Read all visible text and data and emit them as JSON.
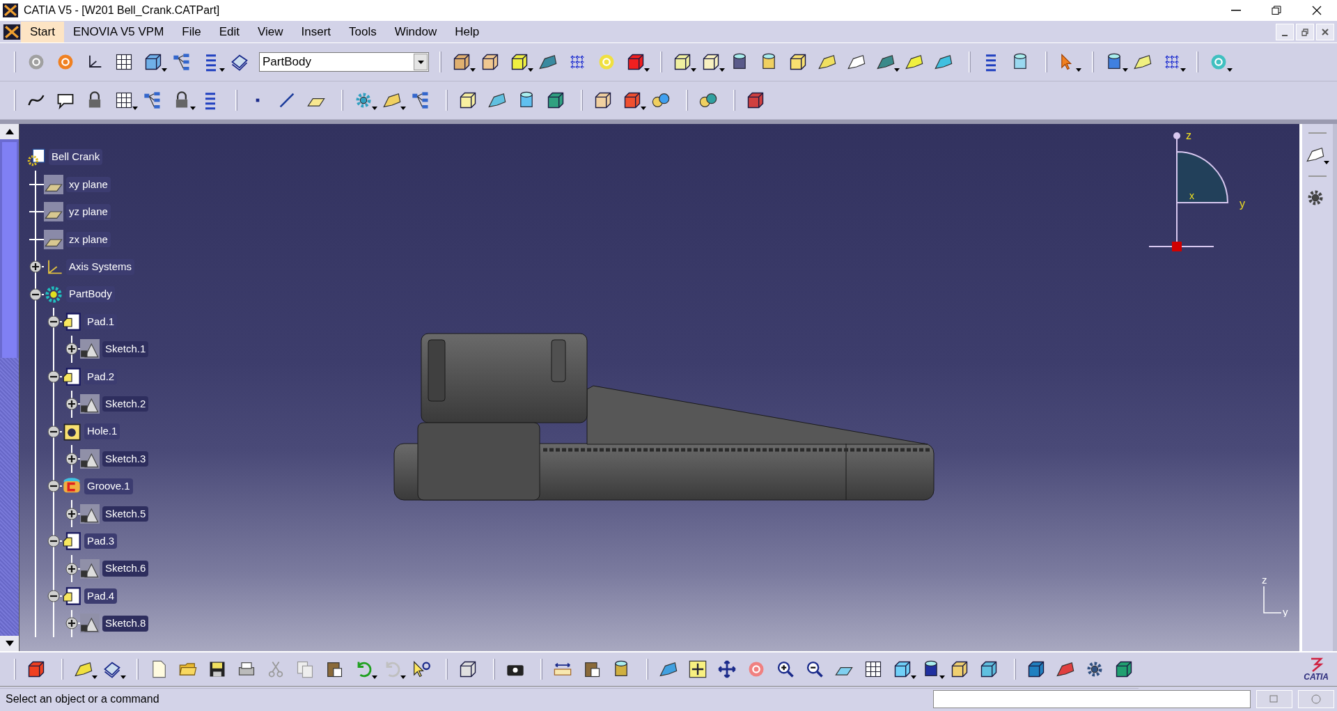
{
  "window": {
    "title": "CATIA V5 - [W201 Bell_Crank.CATPart]"
  },
  "menu": [
    {
      "label": "Start",
      "selected": true
    },
    {
      "label": "ENOVIA V5 VPM",
      "selected": false
    },
    {
      "label": "File",
      "selected": false
    },
    {
      "label": "Edit",
      "selected": false
    },
    {
      "label": "View",
      "selected": false
    },
    {
      "label": "Insert",
      "selected": false
    },
    {
      "label": "Tools",
      "selected": false
    },
    {
      "label": "Window",
      "selected": false
    },
    {
      "label": "Help",
      "selected": false
    }
  ],
  "toolbar": {
    "body_selector": "PartBody"
  },
  "tree": {
    "label": "Bell Crank",
    "kind": "part",
    "children": [
      {
        "label": "xy plane",
        "kind": "plane"
      },
      {
        "label": "yz plane",
        "kind": "plane"
      },
      {
        "label": "zx plane",
        "kind": "plane"
      },
      {
        "label": "Axis Systems",
        "kind": "axis",
        "expanded": false
      },
      {
        "label": "PartBody",
        "kind": "body",
        "expanded": true,
        "children": [
          {
            "label": "Pad.1",
            "kind": "pad",
            "expanded": true,
            "children": [
              {
                "label": "Sketch.1",
                "kind": "sketch",
                "expanded": false
              }
            ]
          },
          {
            "label": "Pad.2",
            "kind": "pad",
            "expanded": true,
            "children": [
              {
                "label": "Sketch.2",
                "kind": "sketch",
                "expanded": false
              }
            ]
          },
          {
            "label": "Hole.1",
            "kind": "hole",
            "expanded": true,
            "children": [
              {
                "label": "Sketch.3",
                "kind": "sketch",
                "expanded": false
              }
            ]
          },
          {
            "label": "Groove.1",
            "kind": "groove",
            "expanded": true,
            "children": [
              {
                "label": "Sketch.5",
                "kind": "sketch",
                "expanded": false
              }
            ]
          },
          {
            "label": "Pad.3",
            "kind": "pad",
            "expanded": true,
            "children": [
              {
                "label": "Sketch.6",
                "kind": "sketch",
                "expanded": false
              }
            ]
          },
          {
            "label": "Pad.4",
            "kind": "pad",
            "expanded": true,
            "children": [
              {
                "label": "Sketch.8",
                "kind": "sketch",
                "expanded": false
              }
            ]
          }
        ]
      }
    ]
  },
  "compass": {
    "labels": [
      "z",
      "y",
      "x"
    ]
  },
  "axis_triad": {
    "labels": [
      "z",
      "y"
    ]
  },
  "logo_text": "CATIA",
  "status_bar": {
    "message": "Select an object or a command"
  }
}
